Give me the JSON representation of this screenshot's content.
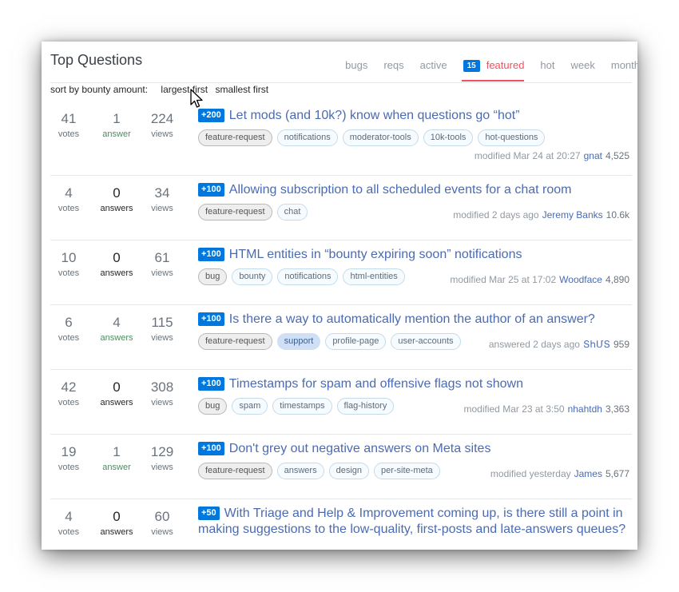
{
  "header": {
    "title": "Top Questions",
    "tabs": [
      {
        "label": "bugs",
        "active": false
      },
      {
        "label": "reqs",
        "active": false
      },
      {
        "label": "active",
        "active": false
      },
      {
        "label": "featured",
        "active": true,
        "count": "15"
      },
      {
        "label": "hot",
        "active": false
      },
      {
        "label": "week",
        "active": false
      },
      {
        "label": "month",
        "active": false
      }
    ]
  },
  "sort": {
    "label": "sort by bounty amount:",
    "options": [
      "largest first",
      "smallest first"
    ]
  },
  "colors": {
    "accent_tab": "#f2505d",
    "bounty_bg": "#0077dd",
    "title_link": "#4a6bb3",
    "answered_green": "#4e8c60"
  },
  "questions": [
    {
      "votes": "41",
      "votes_label": "votes",
      "answers": "1",
      "answers_label": "answer",
      "answered": true,
      "views": "224",
      "views_label": "views",
      "bounty": "+200",
      "title": "Let mods (and 10k?) know when questions go “hot”",
      "tags": [
        "feature-request",
        "notifications",
        "moderator-tools",
        "10k-tools",
        "hot-questions"
      ],
      "action": "modified Mar 24 at 20:27",
      "user": "gnat",
      "rep": "4,525"
    },
    {
      "votes": "4",
      "votes_label": "votes",
      "answers": "0",
      "answers_label": "answers",
      "answered": false,
      "views": "34",
      "views_label": "views",
      "bounty": "+100",
      "title": "Allowing subscription to all scheduled events for a chat room",
      "tags": [
        "feature-request",
        "chat"
      ],
      "action": "modified 2 days ago",
      "user": "Jeremy Banks",
      "rep": "10.6k"
    },
    {
      "votes": "10",
      "votes_label": "votes",
      "answers": "0",
      "answers_label": "answers",
      "answered": false,
      "views": "61",
      "views_label": "views",
      "bounty": "+100",
      "title": "HTML entities in “bounty expiring soon” notifications",
      "tags": [
        "bug",
        "bounty",
        "notifications",
        "html-entities"
      ],
      "action": "modified Mar 25 at 17:02",
      "user": "Woodface",
      "rep": "4,890"
    },
    {
      "votes": "6",
      "votes_label": "votes",
      "answers": "4",
      "answers_label": "answers",
      "answered": true,
      "views": "115",
      "views_label": "views",
      "bounty": "+100",
      "title": "Is there a way to automatically mention the author of an answer?",
      "tags": [
        "feature-request",
        "support",
        "profile-page",
        "user-accounts"
      ],
      "action": "answered 2 days ago",
      "user": "ՏհՄՏ",
      "rep": "959"
    },
    {
      "votes": "42",
      "votes_label": "votes",
      "answers": "0",
      "answers_label": "answers",
      "answered": false,
      "views": "308",
      "views_label": "views",
      "bounty": "+100",
      "title": "Timestamps for spam and offensive flags not shown",
      "tags": [
        "bug",
        "spam",
        "timestamps",
        "flag-history"
      ],
      "action": "modified Mar 23 at 3:50",
      "user": "nhahtdh",
      "rep": "3,363"
    },
    {
      "votes": "19",
      "votes_label": "votes",
      "answers": "1",
      "answers_label": "answer",
      "answered": true,
      "views": "129",
      "views_label": "views",
      "bounty": "+100",
      "title": "Don't grey out negative answers on Meta sites",
      "tags": [
        "feature-request",
        "answers",
        "design",
        "per-site-meta"
      ],
      "action": "modified yesterday",
      "user": "James",
      "rep": "5,677"
    },
    {
      "votes": "4",
      "votes_label": "votes",
      "answers": "0",
      "answers_label": "answers",
      "answered": false,
      "views": "60",
      "views_label": "views",
      "bounty": "+50",
      "title": "With Triage and Help & Improvement coming up, is there still a point in making suggestions to the low-quality, first-posts and late-answers queues?",
      "tags": [],
      "action": "",
      "user": "",
      "rep": ""
    }
  ]
}
